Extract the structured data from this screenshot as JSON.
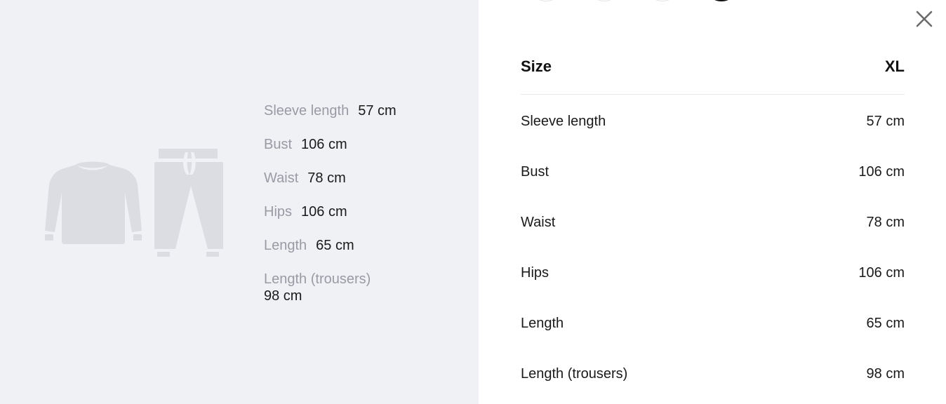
{
  "illustration": {
    "items": [
      "sweatshirt-icon",
      "trousers-icon"
    ],
    "color": "#dcdde3"
  },
  "measures": [
    {
      "label": "Sleeve length",
      "value": "57 cm"
    },
    {
      "label": "Bust",
      "value": "106 cm"
    },
    {
      "label": "Waist",
      "value": "78 cm"
    },
    {
      "label": "Hips",
      "value": "106 cm"
    },
    {
      "label": "Length",
      "value": "65 cm"
    },
    {
      "label": "Length (trousers)",
      "value": "98 cm"
    }
  ],
  "close": {
    "icon": "close-icon"
  },
  "table": {
    "header_label": "Size",
    "header_value": "XL",
    "rows": [
      {
        "label": "Sleeve length",
        "value": "57 cm"
      },
      {
        "label": "Bust",
        "value": "106 cm"
      },
      {
        "label": "Waist",
        "value": "78 cm"
      },
      {
        "label": "Hips",
        "value": "106 cm"
      },
      {
        "label": "Length",
        "value": "65 cm"
      },
      {
        "label": "Length (trousers)",
        "value": "98 cm"
      }
    ]
  },
  "colors": {
    "left_bg": "#f0f1f4",
    "muted_text": "#9a9aa5",
    "text": "#1a1a1a",
    "divider": "#e8e8ec"
  }
}
